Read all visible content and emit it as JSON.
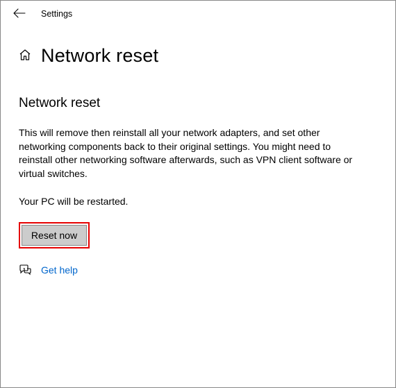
{
  "header": {
    "app_title": "Settings"
  },
  "page": {
    "title": "Network reset",
    "section_title": "Network reset",
    "description": "This will remove then reinstall all your network adapters, and set other networking components back to their original settings. You might need to reinstall other networking software afterwards, such as VPN client software or virtual switches.",
    "restart_note": "Your PC will be restarted.",
    "reset_button": "Reset now",
    "help_link": "Get help"
  }
}
